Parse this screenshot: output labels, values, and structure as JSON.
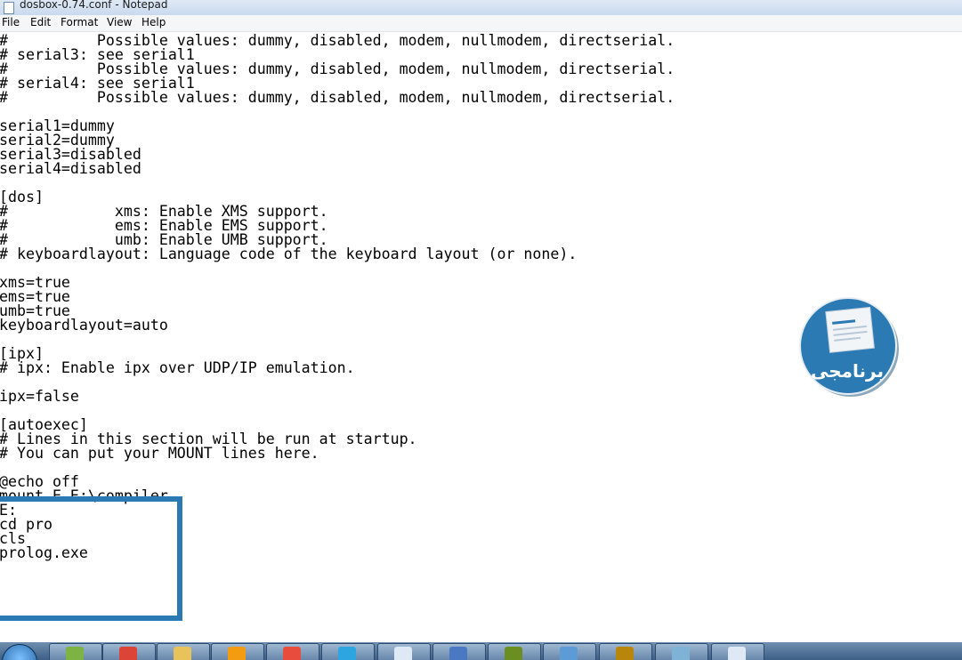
{
  "window": {
    "title": "dosbox-0.74.conf - Notepad"
  },
  "menu": [
    "File",
    "Edit",
    "Format",
    "View",
    "Help"
  ],
  "editor": {
    "lines": [
      "#          Possible values: dummy, disabled, modem, nullmodem, directserial.",
      "# serial3: see serial1",
      "#          Possible values: dummy, disabled, modem, nullmodem, directserial.",
      "# serial4: see serial1",
      "#          Possible values: dummy, disabled, modem, nullmodem, directserial.",
      "",
      "serial1=dummy",
      "serial2=dummy",
      "serial3=disabled",
      "serial4=disabled",
      "",
      "[dos]",
      "#            xms: Enable XMS support.",
      "#            ems: Enable EMS support.",
      "#            umb: Enable UMB support.",
      "# keyboardlayout: Language code of the keyboard layout (or none).",
      "",
      "xms=true",
      "ems=true",
      "umb=true",
      "keyboardlayout=auto",
      "",
      "[ipx]",
      "# ipx: Enable ipx over UDP/IP emulation.",
      "",
      "ipx=false",
      "",
      "[autoexec]",
      "# Lines in this section will be run at startup.",
      "# You can put your MOUNT lines here.",
      "",
      "@echo off",
      "mount E E:\\compiler",
      "E:",
      "cd pro",
      "cls",
      "prolog.exe"
    ]
  },
  "logo": {
    "text": "برنامجى",
    "color": "#2b7ab4"
  },
  "highlight_color": "#2b7ab4",
  "taskbar": {
    "buttons": [
      {
        "icon": "android-icon",
        "color": "#7cb342"
      },
      {
        "icon": "chrome-icon",
        "color": "#db4437"
      },
      {
        "icon": "folder-icon",
        "color": "#e8c25a"
      },
      {
        "icon": "media-player-icon",
        "color": "#f39c12"
      },
      {
        "icon": "app-red-icon",
        "color": "#e74c3c"
      },
      {
        "icon": "telegram-icon",
        "color": "#2ca5e0"
      },
      {
        "icon": "notepad-icon",
        "color": "#dfe9f5"
      },
      {
        "icon": "document-icon",
        "color": "#4a78c2"
      },
      {
        "icon": "pen-icon",
        "color": "#6b8e23"
      },
      {
        "icon": "control-panel-icon",
        "color": "#5c9bd6"
      },
      {
        "icon": "dosbox-icon",
        "color": "#b8860b"
      },
      {
        "icon": "image-viewer-icon",
        "color": "#7fb3d5"
      },
      {
        "icon": "notepad-icon",
        "color": "#dfe9f5"
      }
    ]
  }
}
